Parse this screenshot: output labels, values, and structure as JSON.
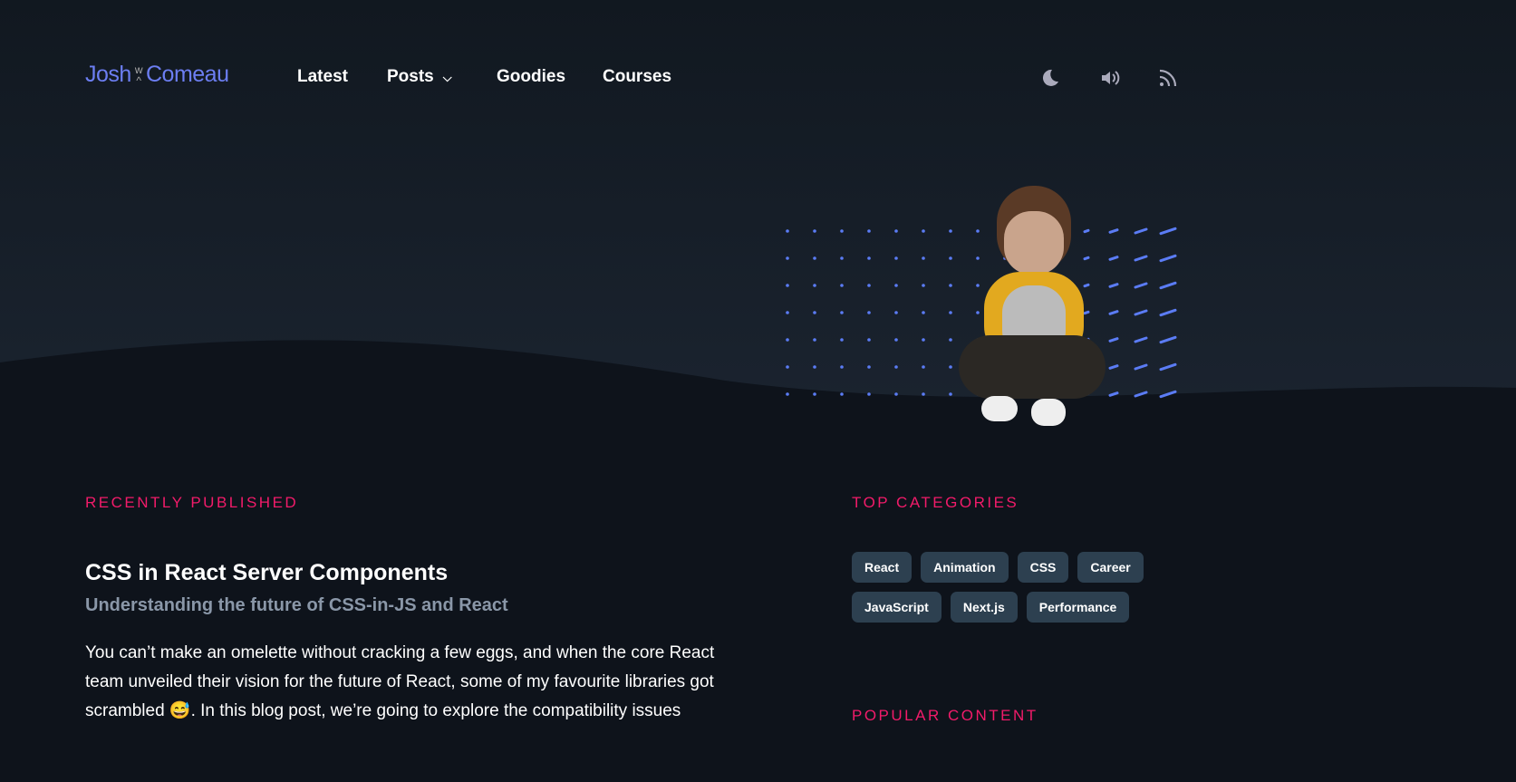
{
  "logo": {
    "first": "Josh",
    "second": "Comeau",
    "top_mark": "w",
    "bottom_mark": "^"
  },
  "nav": {
    "latest": "Latest",
    "posts": "Posts",
    "goodies": "Goodies",
    "courses": "Courses"
  },
  "sections": {
    "recent": "RECENTLY PUBLISHED",
    "categories": "TOP CATEGORIES",
    "popular": "POPULAR CONTENT"
  },
  "post": {
    "title": "CSS in React Server Components",
    "subtitle": "Understanding the future of CSS-in-JS and React",
    "excerpt": "You can’t make an omelette without cracking a few eggs, and when the core React team unveiled their vision for the future of React, some of my favourite libraries got scrambled 😅. In this blog post, we’re going to explore the compatibility issues"
  },
  "categories": [
    "React",
    "Animation",
    "CSS",
    "Career",
    "JavaScript",
    "Next.js",
    "Performance"
  ]
}
